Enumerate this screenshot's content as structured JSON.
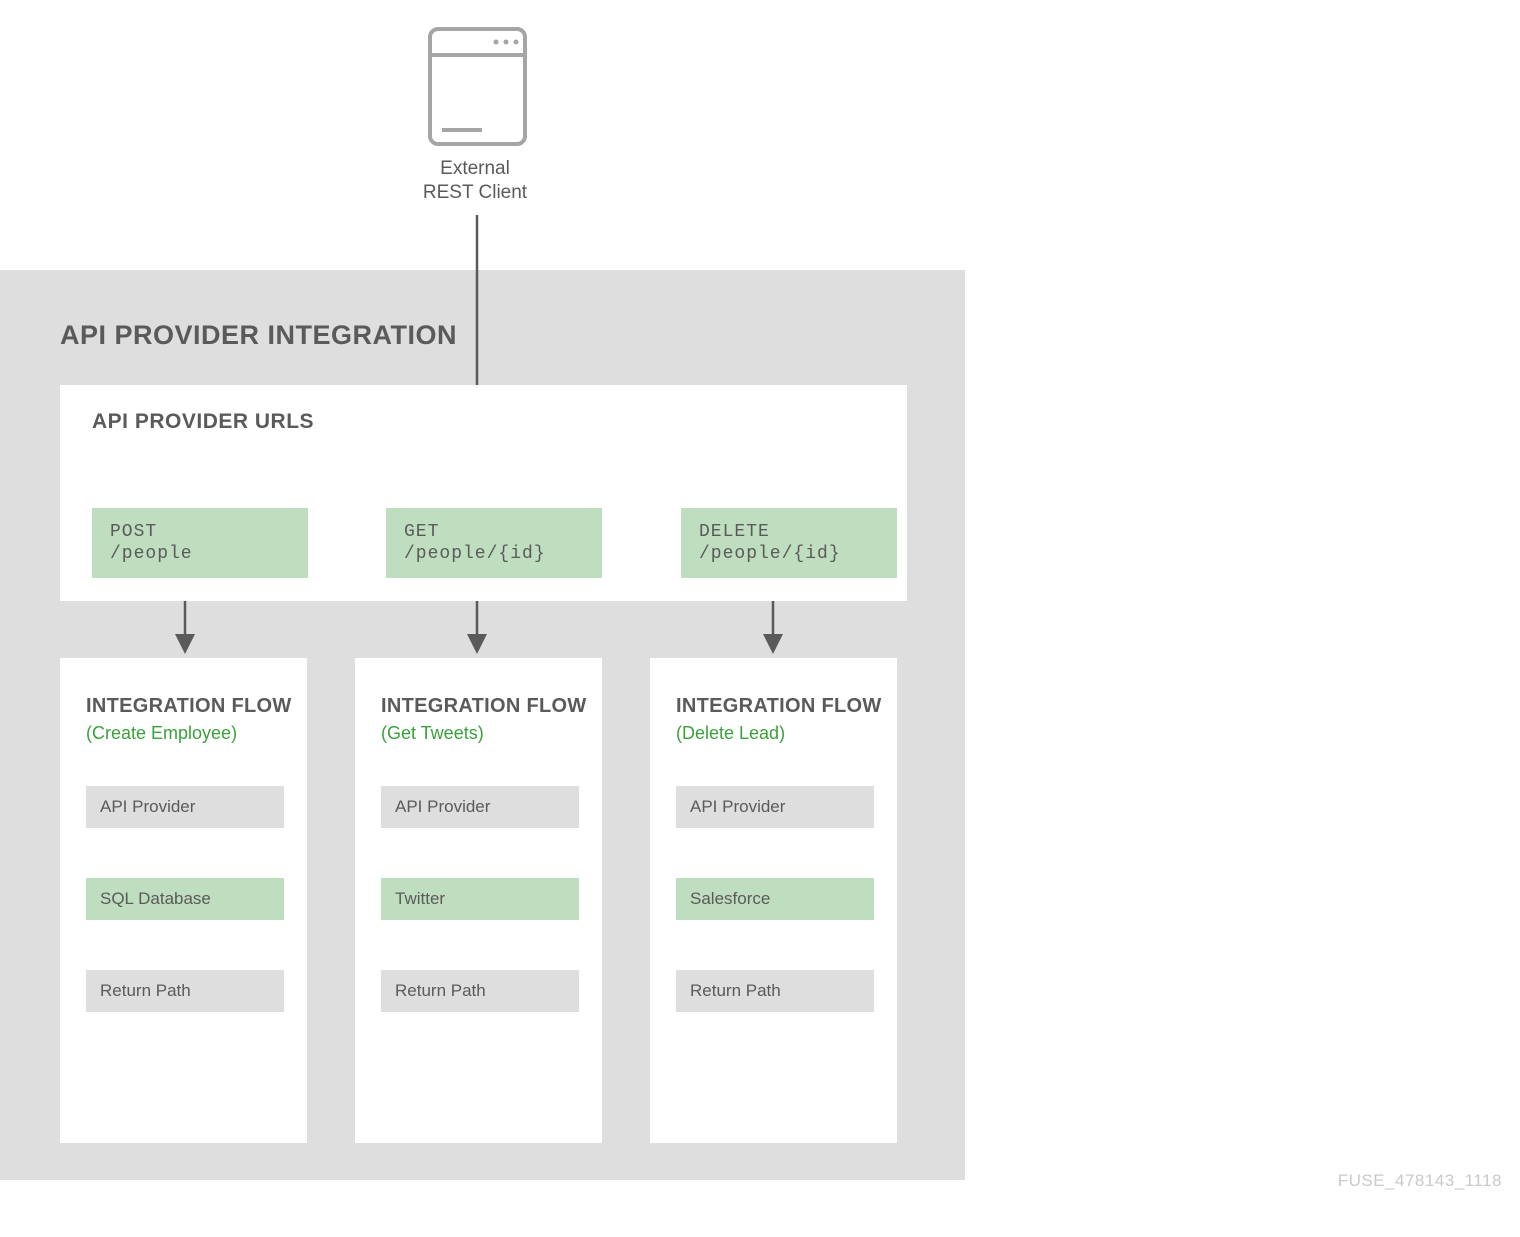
{
  "external_client": {
    "line1": "External",
    "line2": "REST Client"
  },
  "integration_section_title": "API PROVIDER INTEGRATION",
  "urls_section_title": "API PROVIDER URLS",
  "endpoints": [
    {
      "method": "POST",
      "path": "/people"
    },
    {
      "method": "GET",
      "path": "/people/{id}"
    },
    {
      "method": "DELETE",
      "path": "/people/{id}"
    }
  ],
  "flows": [
    {
      "title": "INTEGRATION FLOW",
      "subtitle": "(Create Employee)",
      "steps": [
        {
          "label": "API Provider",
          "style": "gray"
        },
        {
          "label": "SQL Database",
          "style": "green"
        },
        {
          "label": "Return Path",
          "style": "gray"
        }
      ]
    },
    {
      "title": "INTEGRATION FLOW",
      "subtitle": "(Get Tweets)",
      "steps": [
        {
          "label": "API Provider",
          "style": "gray"
        },
        {
          "label": "Twitter",
          "style": "green"
        },
        {
          "label": "Return Path",
          "style": "gray"
        }
      ]
    },
    {
      "title": "INTEGRATION FLOW",
      "subtitle": "(Delete Lead)",
      "steps": [
        {
          "label": "API Provider",
          "style": "gray"
        },
        {
          "label": "Salesforce",
          "style": "green"
        },
        {
          "label": "Return Path",
          "style": "gray"
        }
      ]
    }
  ],
  "footer_id": "FUSE_478143_1118"
}
